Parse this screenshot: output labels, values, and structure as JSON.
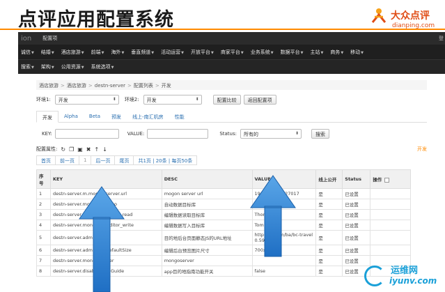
{
  "slide": {
    "title": "点评应用配置系统",
    "logo_brand": "大众点评",
    "logo_domain": "dianping.com"
  },
  "topbar": {
    "brand": "ion",
    "title": "配置项",
    "right": "登"
  },
  "nav1": [
    "诚信",
    "结婚",
    "酒店旅游",
    "前端",
    "海外",
    "垂直频道",
    "活动运营",
    "开放平台",
    "商家平台",
    "业务系统",
    "数据平台",
    "主站",
    "商务",
    "移动"
  ],
  "nav2": [
    "搜索",
    "架构",
    "公用资源",
    "系统选项"
  ],
  "breadcrumb": [
    "酒店旅游",
    "酒店旅游",
    "destn-server",
    "配置列表",
    "开发"
  ],
  "env": {
    "env1_label": "环境1:",
    "env1_value": "开发",
    "env2_label": "环境2:",
    "env2_value": "开发",
    "compare_button": "配置比较",
    "back_button": "返回配置项"
  },
  "tabs": [
    "开发",
    "Alpha",
    "Beta",
    "预发",
    "线上-南汇机房",
    "性能"
  ],
  "search": {
    "key_label": "KEY:",
    "value_label": "VALUE:",
    "status_label": "Status:",
    "status_value": "所有的",
    "search_button": "搜索"
  },
  "props": {
    "label": "配置属性:",
    "env_tag": "开发"
  },
  "pager": [
    "首页",
    "前一页",
    "1",
    "后一页",
    "尾页",
    "共1页 | 20条 | 每页50条"
  ],
  "table": {
    "headers": [
      "序号",
      "KEY",
      "DESC",
      "VALUE",
      "线上公开",
      "Status",
      "操作"
    ],
    "rows": [
      {
        "no": "1",
        "key": "destn-server.m.mongo.server.url",
        "desc": "mogon server url",
        "value": "192.168.218:27017",
        "pub": "是",
        "status": "已设置"
      },
      {
        "no": "2",
        "key": "destn-server.mongo.db.auto",
        "desc": "自动数据目标库",
        "value": "Jerry",
        "pub": "是",
        "status": "已设置"
      },
      {
        "no": "3",
        "key": "destn-server.mongo.db.editor_read",
        "desc": "编辑数据读取目标库",
        "value": "Thor",
        "pub": "是",
        "status": "已设置"
      },
      {
        "no": "4",
        "key": "destn-server.mongo.db.editor_write",
        "desc": "编辑数据写入目标库",
        "value": "Tom",
        "pub": "是",
        "status": "已设置"
      },
      {
        "no": "5",
        "key": "destn-server.admin.jsurl",
        "desc": "目的地后台页面静态JS的URL地址",
        "value": "http://....com/ba/bc-travel 0.59",
        "pub": "是",
        "status": "已设置"
      },
      {
        "no": "6",
        "key": "destn-server.admin.pic.defaultSize",
        "desc": "编辑后台预览图片尺寸",
        "value": "700x70",
        "pub": "是",
        "status": "已设置"
      },
      {
        "no": "7",
        "key": "destn-server.mongo.server",
        "desc": "mongoserver",
        "value": "",
        "pub": "是",
        "status": "已设置"
      },
      {
        "no": "8",
        "key": "destn-server.disableHotelGuide",
        "desc": "app目的地指南功能开关",
        "value": "false",
        "pub": "是",
        "status": "已设置"
      }
    ]
  },
  "watermark": {
    "cn": "运维网",
    "en": "iyunv.com"
  },
  "colors": {
    "accent_orange": "#ff8a00",
    "nav_dark": "#1f1f1f",
    "link_blue": "#2a6fb0",
    "arrow_blue": "#2f7fd0"
  }
}
